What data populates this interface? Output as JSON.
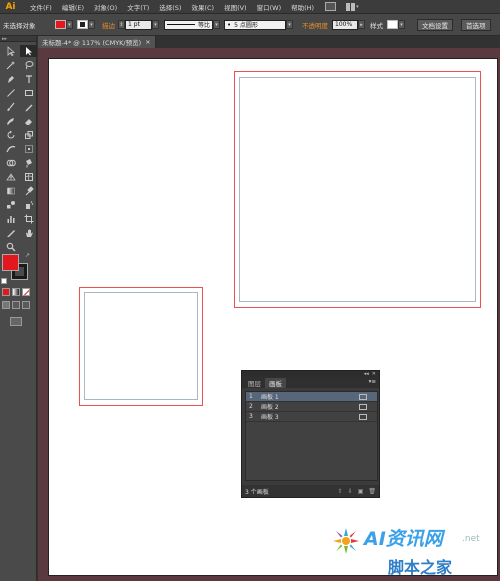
{
  "app": {
    "logo": "Ai"
  },
  "menu": [
    "文件(F)",
    "编辑(E)",
    "对象(O)",
    "文字(T)",
    "选择(S)",
    "效果(C)",
    "视图(V)",
    "窗口(W)",
    "帮助(H)"
  ],
  "control_bar": {
    "selection_status": "未选择对象",
    "stroke_label": "描边",
    "stroke_weight": "1 pt",
    "stroke_style": "等比",
    "brush": "5 点圆形",
    "opacity_label": "不透明度",
    "opacity_value": "100%",
    "style_label": "样式",
    "doc_setup_button": "文档设置",
    "prefs_button": "首选项",
    "fill_color": "#e3181f"
  },
  "document_tab": {
    "title": "未标题-4* @ 117% (CMYK/预览)",
    "close": "×"
  },
  "artboards_panel": {
    "tabs": [
      "图层",
      "画板"
    ],
    "active_tab": "画板",
    "rows": [
      {
        "num": "1",
        "name": "画板 1",
        "selected": true
      },
      {
        "num": "2",
        "name": "画板 2",
        "selected": false
      },
      {
        "num": "3",
        "name": "画板 3",
        "selected": false
      }
    ],
    "footer_count": "3 个画板"
  },
  "watermark": {
    "title": "AI资讯网",
    "net": ".net",
    "subtitle": "脚本之家"
  },
  "colors": {
    "fill": "#e3181f",
    "stroke": "#1a1a1a",
    "artboard_border": "#e8514f",
    "guide": "#a9b8c6"
  }
}
